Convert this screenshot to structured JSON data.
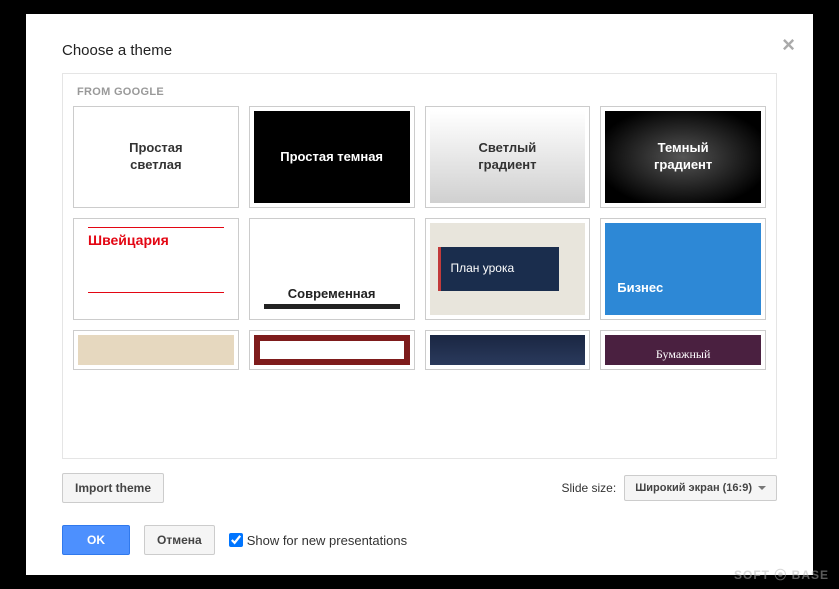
{
  "dialog": {
    "title": "Choose a theme",
    "close_glyph": "×",
    "section_label": "FROM GOOGLE"
  },
  "themes": [
    {
      "id": "simple-light",
      "label": "Простая\nсветлая"
    },
    {
      "id": "simple-dark",
      "label": "Простая темная"
    },
    {
      "id": "light-gradient",
      "label": "Светлый\nградиент"
    },
    {
      "id": "dark-gradient",
      "label": "Темный\nградиент"
    },
    {
      "id": "swiss",
      "label": "Швейцария"
    },
    {
      "id": "modern",
      "label": "Современная"
    },
    {
      "id": "lesson",
      "label": "План урока"
    },
    {
      "id": "business",
      "label": "Бизнес"
    },
    {
      "id": "beige",
      "label": ""
    },
    {
      "id": "redborder",
      "label": ""
    },
    {
      "id": "navy",
      "label": ""
    },
    {
      "id": "paper",
      "label": "Бумажный"
    }
  ],
  "footer": {
    "import_label": "Import theme",
    "slide_size_label": "Slide size:",
    "slide_size_value": "Широкий экран (16:9)",
    "ok_label": "OK",
    "cancel_label": "Отмена",
    "show_new_label": "Show for new presentations",
    "show_new_checked": true
  },
  "watermark": "SOFT ⦿ BASE"
}
